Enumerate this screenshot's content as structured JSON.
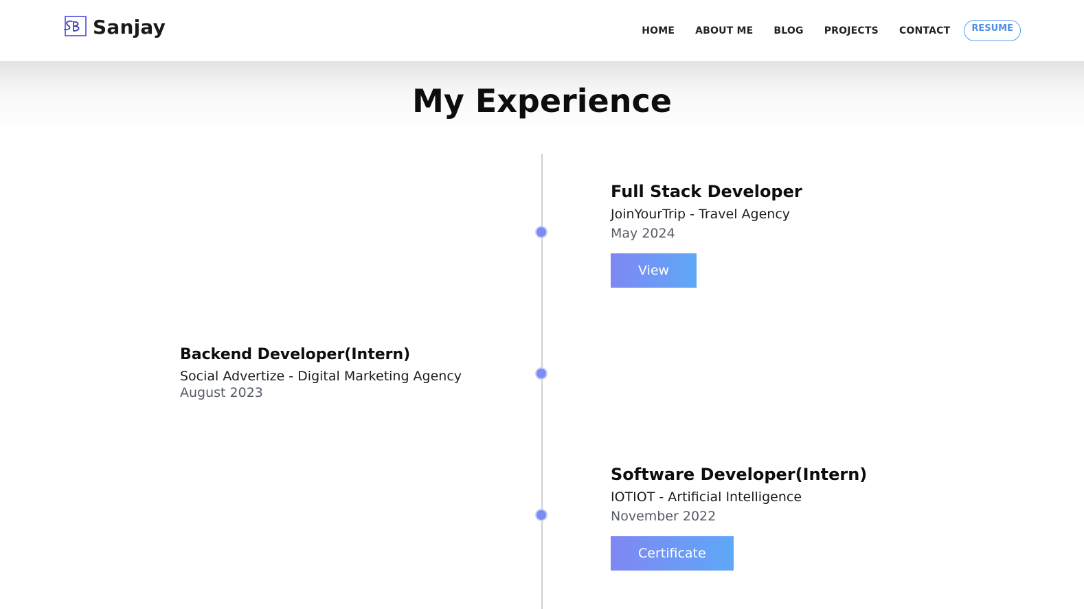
{
  "brand": {
    "logo_icon": "sb-monogram-icon",
    "name": "Sanjay"
  },
  "nav": {
    "items": [
      {
        "label": "HOME"
      },
      {
        "label": "ABOUT ME"
      },
      {
        "label": "BLOG"
      },
      {
        "label": "PROJECTS"
      },
      {
        "label": "CONTACT"
      }
    ],
    "resume_label": "RESUME"
  },
  "section": {
    "title": "My Experience"
  },
  "experiences": [
    {
      "title": "Full Stack Developer",
      "company": "JoinYourTrip - Travel Agency",
      "date": "May 2024",
      "button_label": "View",
      "side": "right"
    },
    {
      "title": "Backend Developer(Intern)",
      "company": "Social Advertize - Digital Marketing Agency",
      "date": "August 2023",
      "side": "left"
    },
    {
      "title": "Software Developer(Intern)",
      "company": "IOTIOT - Artificial Intelligence",
      "date": "November 2022",
      "button_label": "Certificate",
      "side": "right"
    }
  ],
  "colors": {
    "accent": "#7b8cf2",
    "button_gradient_start": "#7f87f4",
    "button_gradient_end": "#5ea8f6",
    "resume_border": "#5a9cf0"
  }
}
